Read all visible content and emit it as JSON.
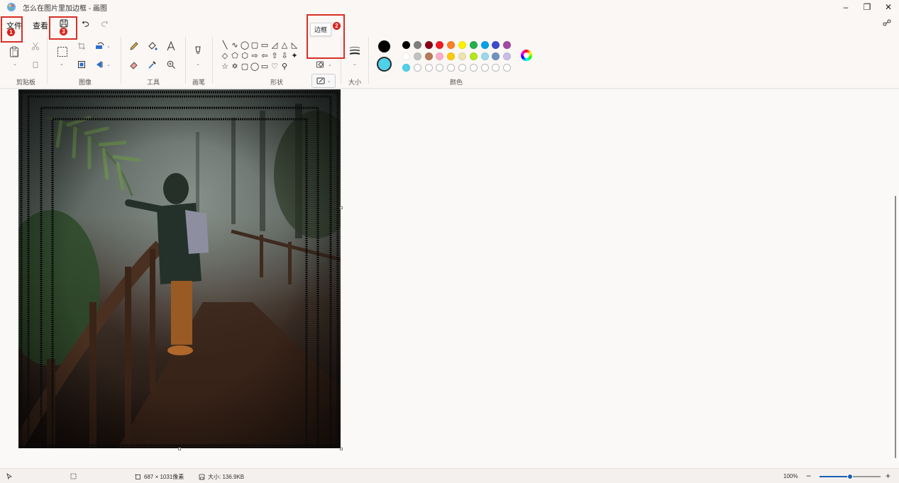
{
  "window": {
    "title": "怎么在图片里加边框 - 画图",
    "minimize": "–",
    "maximize": "❐",
    "close": "✕"
  },
  "menu": {
    "file": "文件",
    "view": "查看"
  },
  "ribbon": {
    "groups": {
      "clipboard": "剪贴板",
      "image": "图像",
      "tools": "工具",
      "brushes": "画笔",
      "shapes": "形状",
      "size": "大小",
      "colors": "颜色"
    },
    "shapes": [
      "╲",
      "∿",
      "◯",
      "▢",
      "▭",
      "◿",
      "△",
      "◺",
      "◇",
      "⬠",
      "⬡",
      "⇨",
      "⇦",
      "⇧",
      "⇩",
      "✦",
      "☆",
      "✡",
      "▢",
      "◯",
      "▭",
      "♡",
      "⚲",
      ""
    ],
    "outline_tooltip": "边框",
    "primary_color": "#000000",
    "secondary_color": "#4fd1ea",
    "palette": [
      "#000000",
      "#7f7f7f",
      "#880015",
      "#ed1c24",
      "#ff7f27",
      "#fff200",
      "#22b14c",
      "#00a2e8",
      "#3f48cc",
      "#a349a4",
      "#ffffff",
      "#c3c3c3",
      "#b97a57",
      "#ffaec9",
      "#ffc90e",
      "#efe4b0",
      "#b5e61d",
      "#99d9ea",
      "#7092be",
      "#c8bfe7",
      "#4fd1ea",
      "",
      "",
      "",
      "",
      "",
      "",
      "",
      "",
      ""
    ]
  },
  "annotations": [
    "1",
    "2",
    "3"
  ],
  "status": {
    "dimensions": "687 × 1031像素",
    "size": "大小: 136.9KB",
    "zoom": "100%",
    "zoom_level": 0.5,
    "zoom_out": "−",
    "zoom_in": "+"
  }
}
